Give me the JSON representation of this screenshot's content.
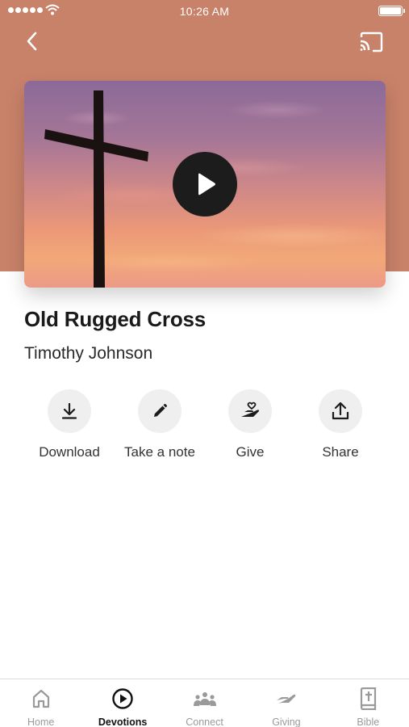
{
  "status_bar": {
    "time": "10:26 AM",
    "signal_icon": "signal-dots-icon",
    "wifi_icon": "wifi-icon",
    "battery_icon": "battery-icon"
  },
  "header": {
    "back_icon": "chevron-left-icon",
    "cast_icon": "cast-icon",
    "background_color": "#c9826a"
  },
  "media": {
    "play_icon": "play-icon"
  },
  "content": {
    "title": "Old Rugged Cross",
    "author": "Timothy Johnson"
  },
  "actions": [
    {
      "label": "Download",
      "icon": "download-icon"
    },
    {
      "label": "Take a note",
      "icon": "pencil-icon"
    },
    {
      "label": "Give",
      "icon": "heart-hand-icon"
    },
    {
      "label": "Share",
      "icon": "share-icon"
    }
  ],
  "tabs": [
    {
      "label": "Home",
      "icon": "home-icon",
      "active": false
    },
    {
      "label": "Devotions",
      "icon": "play-circle-icon",
      "active": true
    },
    {
      "label": "Connect",
      "icon": "people-icon",
      "active": false
    },
    {
      "label": "Giving",
      "icon": "giving-hand-icon",
      "active": false
    },
    {
      "label": "Bible",
      "icon": "bible-icon",
      "active": false
    }
  ],
  "colors": {
    "accent": "#c9826a",
    "active_tab": "#111111",
    "inactive_tab": "#9a9a9a",
    "action_circle": "#efefef"
  }
}
